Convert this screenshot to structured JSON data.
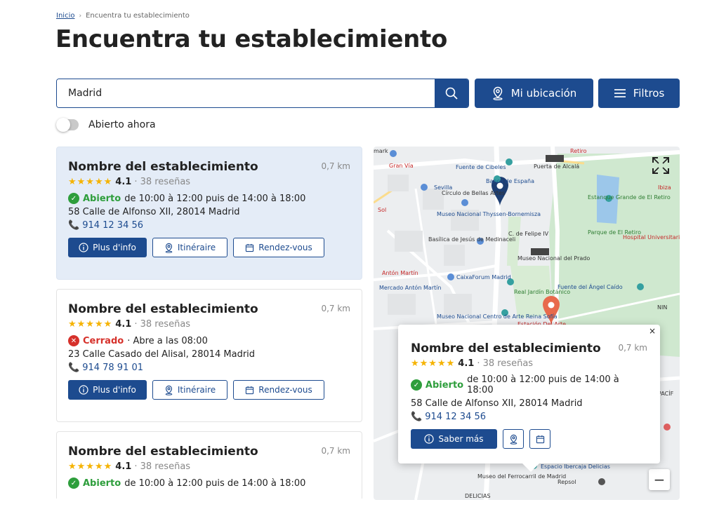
{
  "breadcrumb": {
    "home": "Inicio",
    "current": "Encuentra tu establecimiento"
  },
  "page_title": "Encuentra tu establecimiento",
  "search": {
    "value": "Madrid",
    "placeholder": ""
  },
  "buttons": {
    "location": "Mi ubicación",
    "filters": "Filtros"
  },
  "toggle": {
    "label": "Abierto ahora",
    "on": false
  },
  "colors": {
    "primary": "#1d4b8f",
    "open": "#2e9e3c",
    "closed": "#d6312b",
    "star": "#f5b301"
  },
  "results": [
    {
      "name": "Nombre del establecimiento",
      "distance": "0,7 km",
      "stars": "★★★★★",
      "rating": "4.1",
      "reviews": "· 38 reseñas",
      "status": "Abierto",
      "status_open": true,
      "hours": "de 10:00 à 12:00 puis de 14:00 à 18:00",
      "address": "58 Calle de Alfonso XII, 28014 Madrid",
      "phone": "914 12 34 56",
      "btn_info": "Plus d'info",
      "btn_route": "Itinéraire",
      "btn_appointment": "Rendez-vous"
    },
    {
      "name": "Nombre del establecimiento",
      "distance": "0,7 km",
      "stars": "★★★★★",
      "rating": "4.1",
      "reviews": "· 38 reseñas",
      "status": "Cerrado",
      "status_open": false,
      "hours": "· Abre a las 08:00",
      "address": "23 Calle Casado del Alisal, 28014 Madrid",
      "phone": "914 78 91 01",
      "btn_info": "Plus d'info",
      "btn_route": "Itinéraire",
      "btn_appointment": "Rendez-vous"
    },
    {
      "name": "Nombre del establecimiento",
      "distance": "0,7 km",
      "stars": "★★★★★",
      "rating": "4.1",
      "reviews": "· 38 reseñas",
      "status": "Abierto",
      "status_open": true,
      "hours": "de 10:00 à 12:00 puis de 14:00 à 18:00"
    }
  ],
  "popup": {
    "name": "Nombre del establecimiento",
    "distance": "0,7 km",
    "stars": "★★★★★",
    "rating": "4.1",
    "reviews": "· 38 reseñas",
    "status": "Abierto",
    "hours": "de 10:00 à 12:00 puis de 14:00 à 18:00",
    "address": "58 Calle de Alfonso XII, 28014 Madrid",
    "phone": "914 12 34 56",
    "btn_more": "Saber más"
  },
  "map": {
    "labels": {
      "mark": "mark",
      "gran_via": "Gran Vía",
      "fuente_cibeles": "Fuente de Cibeles",
      "puerta_alcala": "Puerta de Alcalá",
      "retiro": "Retiro",
      "banco_espana": "Banco de España",
      "sevilla": "Sevilla",
      "circulo": "Círculo de Bellas Artes",
      "ibiza": "Ibiza",
      "estanque": "Estanque Grande de El Retiro",
      "sol": "Sol",
      "thyssen": "Museo Nacional Thyssen-Bornemisza",
      "felipe": "C. de Felipe IV",
      "parque": "Parque de El Retiro",
      "hospital": "Hospital Universitario Infantil Niño Jesús",
      "basilica": "Basílica de Jesús de Medinaceli",
      "prado": "Museo Nacional del Prado",
      "anton_martin": "Antón Martín",
      "caixaforum": "CaixaForum Madrid",
      "mercado": "Mercado Antón Martín",
      "jardin": "Real Jardín Botánico",
      "angel_caido": "Fuente del Ángel Caído",
      "reina_sofia": "Museo Nacional Centro de Arte Reina Sofía",
      "estacion": "Estación Del Arte",
      "ferrocarril": "Museo del Ferrocarril de Madrid",
      "delicias": "DELICIAS",
      "ibercaja": "Espacio Ibercaja Delicias",
      "repsol": "Repsol",
      "pacif": "PACÍF",
      "nin": "NIN"
    }
  }
}
